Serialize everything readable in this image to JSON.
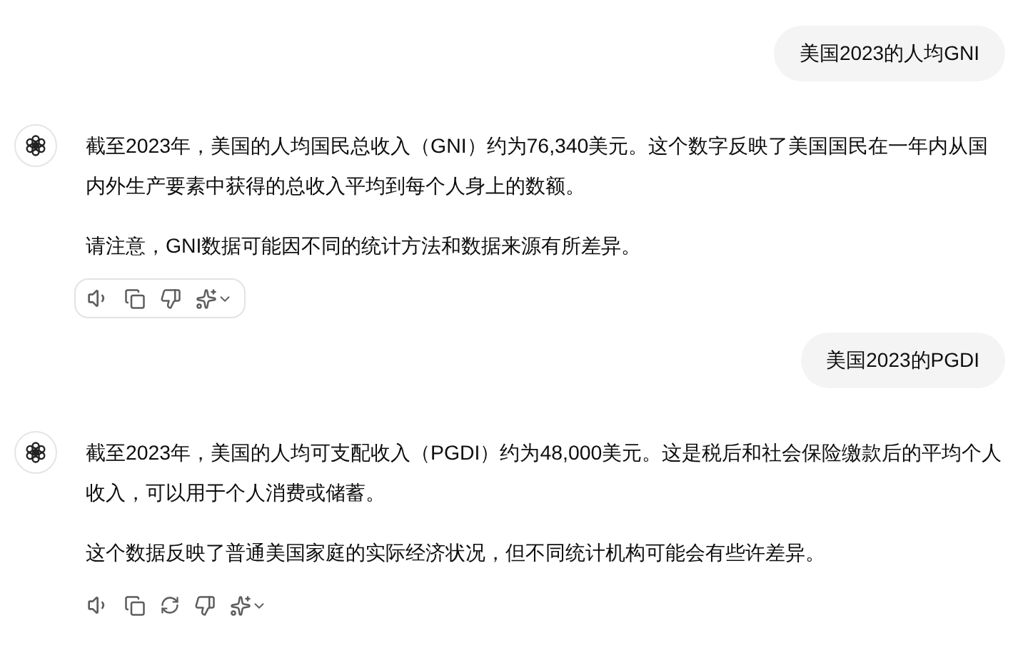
{
  "messages": [
    {
      "kind": "user",
      "text": "美国2023的人均GNI"
    },
    {
      "kind": "assistant",
      "paragraphs": [
        "截至2023年，美国的人均国民总收入（GNI）约为76,340美元。这个数字反映了美国国民在一年内从国内外生产要素中获得的总收入平均到每个人身上的数额。",
        "请注意，GNI数据可能因不同的统计方法和数据来源有所差异。"
      ],
      "actions_highlighted": true,
      "actions": [
        {
          "kind": "speaker"
        },
        {
          "kind": "copy"
        },
        {
          "kind": "thumbs-down"
        },
        {
          "kind": "sparkle"
        }
      ]
    },
    {
      "kind": "user",
      "text": "美国2023的PGDI"
    },
    {
      "kind": "assistant",
      "paragraphs": [
        "截至2023年，美国的人均可支配收入（PGDI）约为48,000美元。这是税后和社会保险缴款后的平均个人收入，可以用于个人消费或储蓄。",
        "这个数据反映了普通美国家庭的实际经济状况，但不同统计机构可能会有些许差异。"
      ],
      "actions_highlighted": false,
      "actions": [
        {
          "kind": "speaker"
        },
        {
          "kind": "copy"
        },
        {
          "kind": "regenerate"
        },
        {
          "kind": "thumbs-down"
        },
        {
          "kind": "sparkle"
        }
      ]
    }
  ]
}
